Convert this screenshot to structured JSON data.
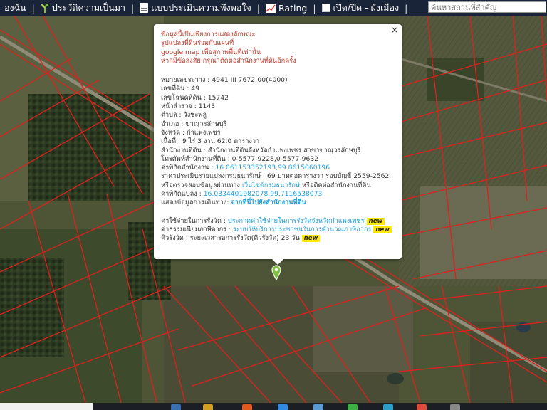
{
  "toolbar": {
    "item_home": "องฉัน",
    "item_history": "ประวัติความเป็นมา",
    "item_survey": "แบบประเมินความพึงพอใจ",
    "item_rating": "Rating",
    "item_layer": "เปิด/ปิด - ผังเมือง",
    "separator": "|",
    "search_placeholder": "ค้นหาสถานที่สำคัญ"
  },
  "icons": {
    "history": "sprout-icon",
    "survey": "document-icon",
    "rating": "chart-icon",
    "layer": "checkbox-icon",
    "close": "close-icon",
    "marker": "map-pin-icon"
  },
  "colors": {
    "toolbar_bg": "#1a2438",
    "parcel_line": "#e0201c",
    "notice_text": "#c0392b",
    "link": "#1e9fe0",
    "badge": "#ffea00",
    "marker": "#7fbf3f"
  },
  "popup": {
    "close": "×",
    "notice": [
      "ข้อมูลนี้เป็นเพียงการแสดงลักษณะ",
      "รูปแปลงที่ดินร่วมกับแผนที่",
      "google map เพื่อสุภาพพื้นที่เท่านั้น",
      "หากมีข้อสงสัย กรุณาติดต่อสำนักงานที่ดินอีกครั้ง"
    ],
    "sheet_label": "หมายเลขระวาง : ",
    "sheet_value": "4941 III 7672-00(4000)",
    "parcel_label": "เลขที่ดิน : ",
    "parcel_value": "49",
    "deed_label": "เลขโฉนดที่ดิน : ",
    "deed_value": "15742",
    "survey_page_label": "หน้าสำรวจ : ",
    "survey_page_value": "1143",
    "subdistrict_label": "ตำบล : ",
    "subdistrict_value": "วังชะพลู",
    "district_label": "อำเภอ : ",
    "district_value": "ขาณุวรลักษบุรี",
    "province_label": "จังหวัด : ",
    "province_value": "กำแพงเพชร",
    "area_label": "เนื้อที่ : ",
    "area_value": "9 ไร่ 3 งาน 62.0 ตารางวา",
    "office_label": "สำนักงานที่ดิน : ",
    "office_value": "สำนักงานที่ดินจังหวัดกำแพงเพชร สาขาขาณุวรลักษบุรี",
    "phone_label": "โทรศัพท์สำนักงานที่ดิน : ",
    "phone_value": "0-5577-9228,0-5577-9632",
    "office_coord_label": "ค่าพิกัดสำนักงาน : ",
    "office_coord_value": "16.061153352193,99.8615060196",
    "appraisal_label": "ราคาประเมินรายแปลงกรมธนารักษ์ : ",
    "appraisal_value": "69 บาทต่อตารางวา รอบบัญชี 2559-2562",
    "check_prefix": "หรือตรวจสอบข้อมูลผ่านทาง ",
    "check_link": "เว็บไซต์กรมธนารักษ์",
    "check_suffix": " หรือติดต่อสำนักงานที่ดิน",
    "parcel_coord_label": "ค่าพิกัดแปลง : ",
    "parcel_coord_value": "16.0334401982078,99.7116538073",
    "route_label": "แสดงข้อมูลการเดินทาง: ",
    "route_link": "จากที่นี่ไปยังสำนักงานที่ดิน",
    "fee_label": "ค่าใช้จ่ายในการรังวัด : ",
    "fee_link": "ประกาศค่าใช้จ่ายในการรังวัดจังหวัดกำแพงเพชร",
    "tax_label": "ค่าธรรมเนียมภาษีอากร : ",
    "tax_link": "ระบบให้บริการประชาชนในการคำนวณภาษีอากร",
    "queue_label": "คิวรังวัด : ",
    "queue_value": "ระยะเวลารอการรังวัด(คิวรังวัด) 23 วัน",
    "badge": "new"
  }
}
